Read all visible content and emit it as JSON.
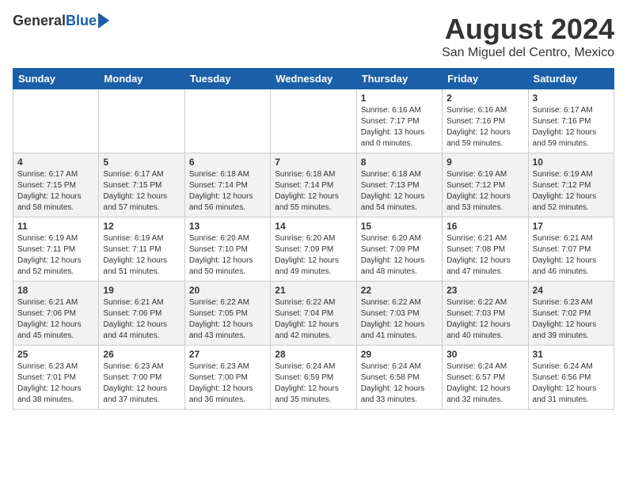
{
  "header": {
    "logo_general": "General",
    "logo_blue": "Blue",
    "month_year": "August 2024",
    "location": "San Miguel del Centro, Mexico"
  },
  "days_of_week": [
    "Sunday",
    "Monday",
    "Tuesday",
    "Wednesday",
    "Thursday",
    "Friday",
    "Saturday"
  ],
  "weeks": [
    [
      {
        "day": "",
        "info": ""
      },
      {
        "day": "",
        "info": ""
      },
      {
        "day": "",
        "info": ""
      },
      {
        "day": "",
        "info": ""
      },
      {
        "day": "1",
        "info": "Sunrise: 6:16 AM\nSunset: 7:17 PM\nDaylight: 13 hours\nand 0 minutes."
      },
      {
        "day": "2",
        "info": "Sunrise: 6:16 AM\nSunset: 7:16 PM\nDaylight: 12 hours\nand 59 minutes."
      },
      {
        "day": "3",
        "info": "Sunrise: 6:17 AM\nSunset: 7:16 PM\nDaylight: 12 hours\nand 59 minutes."
      }
    ],
    [
      {
        "day": "4",
        "info": "Sunrise: 6:17 AM\nSunset: 7:15 PM\nDaylight: 12 hours\nand 58 minutes."
      },
      {
        "day": "5",
        "info": "Sunrise: 6:17 AM\nSunset: 7:15 PM\nDaylight: 12 hours\nand 57 minutes."
      },
      {
        "day": "6",
        "info": "Sunrise: 6:18 AM\nSunset: 7:14 PM\nDaylight: 12 hours\nand 56 minutes."
      },
      {
        "day": "7",
        "info": "Sunrise: 6:18 AM\nSunset: 7:14 PM\nDaylight: 12 hours\nand 55 minutes."
      },
      {
        "day": "8",
        "info": "Sunrise: 6:18 AM\nSunset: 7:13 PM\nDaylight: 12 hours\nand 54 minutes."
      },
      {
        "day": "9",
        "info": "Sunrise: 6:19 AM\nSunset: 7:12 PM\nDaylight: 12 hours\nand 53 minutes."
      },
      {
        "day": "10",
        "info": "Sunrise: 6:19 AM\nSunset: 7:12 PM\nDaylight: 12 hours\nand 52 minutes."
      }
    ],
    [
      {
        "day": "11",
        "info": "Sunrise: 6:19 AM\nSunset: 7:11 PM\nDaylight: 12 hours\nand 52 minutes."
      },
      {
        "day": "12",
        "info": "Sunrise: 6:19 AM\nSunset: 7:11 PM\nDaylight: 12 hours\nand 51 minutes."
      },
      {
        "day": "13",
        "info": "Sunrise: 6:20 AM\nSunset: 7:10 PM\nDaylight: 12 hours\nand 50 minutes."
      },
      {
        "day": "14",
        "info": "Sunrise: 6:20 AM\nSunset: 7:09 PM\nDaylight: 12 hours\nand 49 minutes."
      },
      {
        "day": "15",
        "info": "Sunrise: 6:20 AM\nSunset: 7:09 PM\nDaylight: 12 hours\nand 48 minutes."
      },
      {
        "day": "16",
        "info": "Sunrise: 6:21 AM\nSunset: 7:08 PM\nDaylight: 12 hours\nand 47 minutes."
      },
      {
        "day": "17",
        "info": "Sunrise: 6:21 AM\nSunset: 7:07 PM\nDaylight: 12 hours\nand 46 minutes."
      }
    ],
    [
      {
        "day": "18",
        "info": "Sunrise: 6:21 AM\nSunset: 7:06 PM\nDaylight: 12 hours\nand 45 minutes."
      },
      {
        "day": "19",
        "info": "Sunrise: 6:21 AM\nSunset: 7:06 PM\nDaylight: 12 hours\nand 44 minutes."
      },
      {
        "day": "20",
        "info": "Sunrise: 6:22 AM\nSunset: 7:05 PM\nDaylight: 12 hours\nand 43 minutes."
      },
      {
        "day": "21",
        "info": "Sunrise: 6:22 AM\nSunset: 7:04 PM\nDaylight: 12 hours\nand 42 minutes."
      },
      {
        "day": "22",
        "info": "Sunrise: 6:22 AM\nSunset: 7:03 PM\nDaylight: 12 hours\nand 41 minutes."
      },
      {
        "day": "23",
        "info": "Sunrise: 6:22 AM\nSunset: 7:03 PM\nDaylight: 12 hours\nand 40 minutes."
      },
      {
        "day": "24",
        "info": "Sunrise: 6:23 AM\nSunset: 7:02 PM\nDaylight: 12 hours\nand 39 minutes."
      }
    ],
    [
      {
        "day": "25",
        "info": "Sunrise: 6:23 AM\nSunset: 7:01 PM\nDaylight: 12 hours\nand 38 minutes."
      },
      {
        "day": "26",
        "info": "Sunrise: 6:23 AM\nSunset: 7:00 PM\nDaylight: 12 hours\nand 37 minutes."
      },
      {
        "day": "27",
        "info": "Sunrise: 6:23 AM\nSunset: 7:00 PM\nDaylight: 12 hours\nand 36 minutes."
      },
      {
        "day": "28",
        "info": "Sunrise: 6:24 AM\nSunset: 6:59 PM\nDaylight: 12 hours\nand 35 minutes."
      },
      {
        "day": "29",
        "info": "Sunrise: 6:24 AM\nSunset: 6:58 PM\nDaylight: 12 hours\nand 33 minutes."
      },
      {
        "day": "30",
        "info": "Sunrise: 6:24 AM\nSunset: 6:57 PM\nDaylight: 12 hours\nand 32 minutes."
      },
      {
        "day": "31",
        "info": "Sunrise: 6:24 AM\nSunset: 6:56 PM\nDaylight: 12 hours\nand 31 minutes."
      }
    ]
  ]
}
